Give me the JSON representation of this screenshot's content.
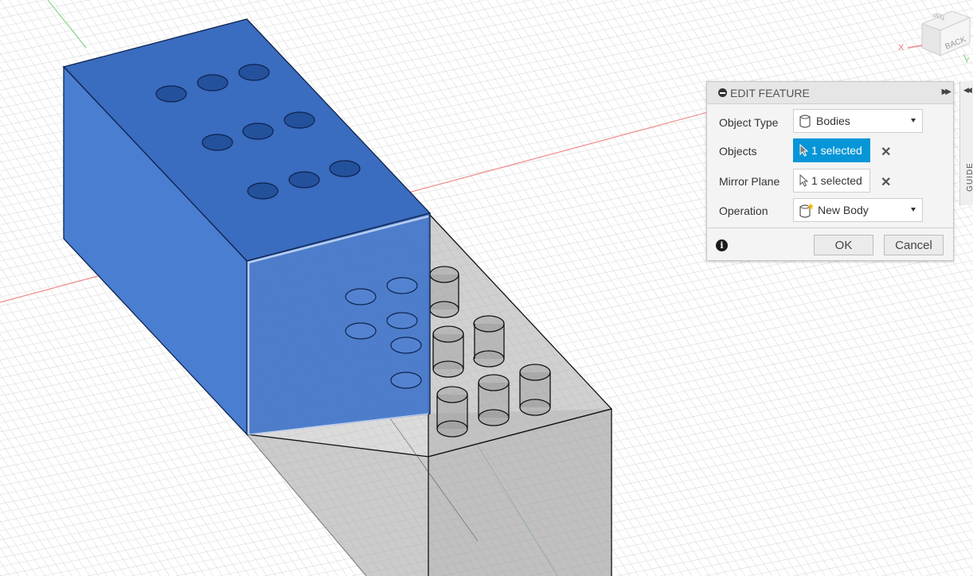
{
  "dialog": {
    "title": "EDIT FEATURE",
    "rows": [
      {
        "label": "Object Type",
        "value": "Bodies"
      },
      {
        "label": "Objects",
        "value": "1 selected"
      },
      {
        "label": "Mirror Plane",
        "value": "1 selected"
      },
      {
        "label": "Operation",
        "value": "New Body"
      }
    ],
    "ok_label": "OK",
    "cancel_label": "Cancel",
    "info_glyph": "i"
  },
  "viewcube": {
    "face_label": "BACK",
    "top_label": "TOP",
    "x_axis_label": "X",
    "y_axis_label": "Y"
  },
  "side_panel": {
    "label": "GUIDE"
  },
  "colors": {
    "selected_body": "#3e73c4",
    "selection_accent": "#0696d7",
    "grid": "#dcdcdc",
    "x_axis": "#f07b7b",
    "y_axis": "#7bd47b",
    "ghost_body": "#a9a9a9"
  },
  "icons": [
    "body-icon",
    "cursor-icon",
    "new-body-icon",
    "close-icon",
    "info-icon",
    "minus-circle-icon",
    "expand-icon",
    "collapse-icon"
  ]
}
